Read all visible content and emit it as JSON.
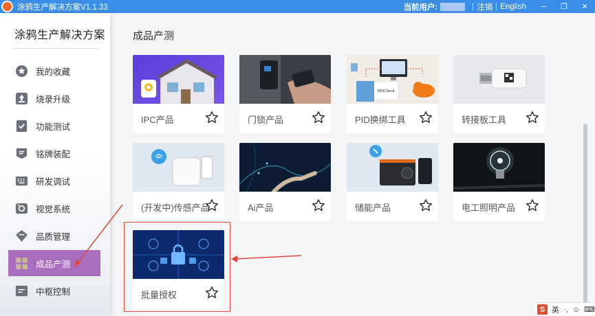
{
  "titlebar": {
    "app_title": "涂鸦生产解决方案V1.1.33",
    "user_label": "当前用户:",
    "logout": "注销",
    "language": "English",
    "minimize": "─",
    "restore": "❐",
    "close": "✕"
  },
  "sidebar": {
    "title": "涂鸦生产解决方案",
    "items": [
      {
        "label": "我的收藏",
        "icon": "star-icon"
      },
      {
        "label": "烧录升级",
        "icon": "upload-icon"
      },
      {
        "label": "功能测试",
        "icon": "checklist-icon"
      },
      {
        "label": "铭牌装配",
        "icon": "nameplate-icon"
      },
      {
        "label": "研发调试",
        "icon": "keyboard-icon"
      },
      {
        "label": "视觉系统",
        "icon": "camera-icon"
      },
      {
        "label": "品质管理",
        "icon": "quality-icon"
      },
      {
        "label": "成品产测",
        "icon": "grid-icon",
        "active": true
      },
      {
        "label": "中枢控制",
        "icon": "control-icon"
      }
    ]
  },
  "main": {
    "title": "成品产测",
    "cards": [
      {
        "label": "IPC产品"
      },
      {
        "label": "门锁产品"
      },
      {
        "label": "PID换绑工具",
        "image_text": "PIDCheck"
      },
      {
        "label": "转接板工具"
      },
      {
        "label": "(开发中)传感产品"
      },
      {
        "label": "Ai产品"
      },
      {
        "label": "储能产品"
      },
      {
        "label": "电工照明产品"
      },
      {
        "label": "批量授权"
      }
    ]
  },
  "tray": {
    "ime_logo": "S",
    "ime_lang": "英"
  },
  "colors": {
    "titlebar": "#3a8ee6",
    "active_item": "#a96dbd",
    "annotation": "#e0473a"
  }
}
